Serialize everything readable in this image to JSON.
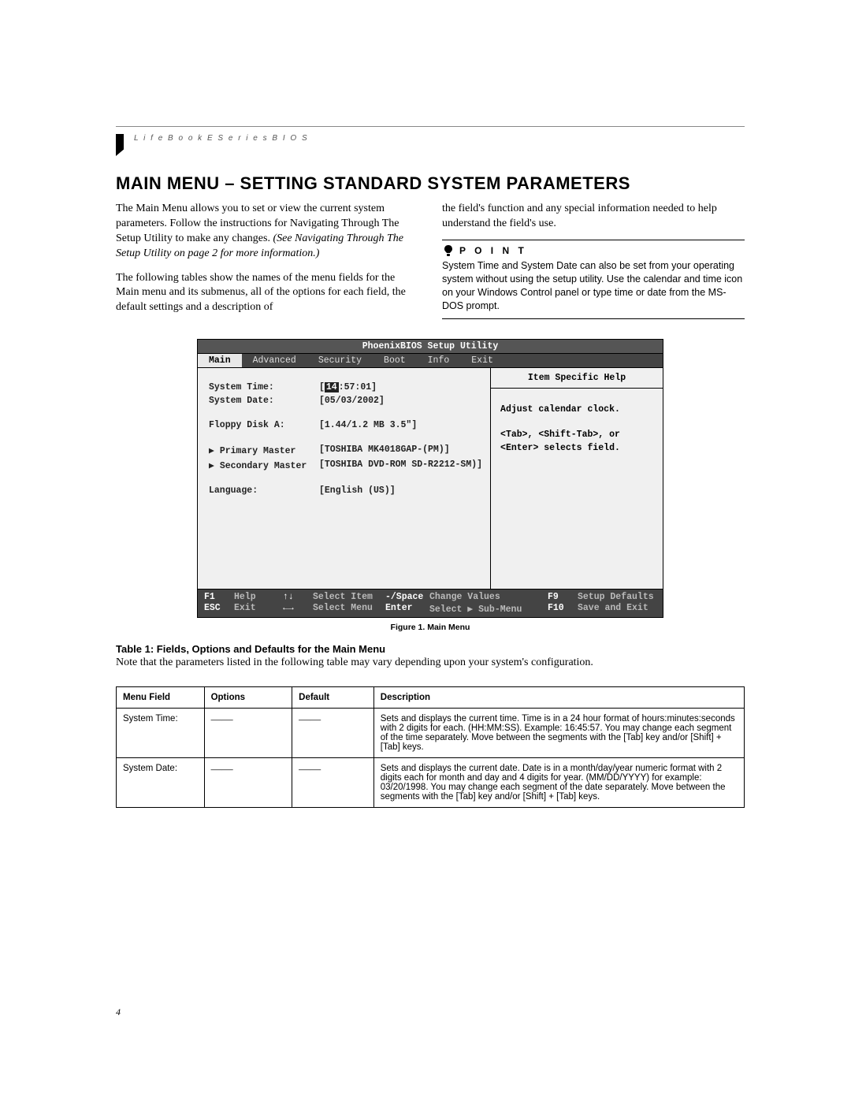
{
  "header": {
    "runningHead": "L i f e B o o k   E   S e r i e s   B I O S"
  },
  "title": "MAIN MENU – SETTING STANDARD SYSTEM PARAMETERS",
  "intro": {
    "p1": "The Main Menu allows you to set or view the current system parameters. Follow the instructions for Navigating Through The Setup Utility to make any changes. ",
    "p1_italic": "(See Navigating Through The Setup Utility on page 2 for more information.)",
    "p2": "The following tables show the names of the menu fields for the Main menu and its submenus, all of the options for each field, the default settings and a description of",
    "p3": "the field's function and any special information needed to help understand the field's use."
  },
  "point": {
    "label": "P O I N T",
    "text": "System Time and System Date can also be set from your operating system without using the setup utility. Use the calendar and time icon on your Windows Control panel or type time or date from the MS-DOS prompt."
  },
  "bios": {
    "title": "PhoenixBIOS Setup Utility",
    "menu": [
      "Main",
      "Advanced",
      "Security",
      "Boot",
      "Info",
      "Exit"
    ],
    "activeMenu": "Main",
    "rows": {
      "systemTime": {
        "label": "System Time:",
        "valPrefix": "[",
        "valHl": "14",
        "valSuffix": ":57:01]"
      },
      "systemDate": {
        "label": "System Date:",
        "val": "[05/03/2002]"
      },
      "floppy": {
        "label": "Floppy Disk A:",
        "val": "[1.44/1.2 MB 3.5\"]"
      },
      "primary": {
        "label": "▶ Primary Master",
        "val": "[TOSHIBA MK4018GAP-(PM)]"
      },
      "secondary": {
        "label": "▶ Secondary Master",
        "val": "[TOSHIBA DVD-ROM SD-R2212-SM)]"
      },
      "language": {
        "label": "Language:",
        "val": "[English (US)]"
      }
    },
    "help": {
      "title": "Item Specific Help",
      "line1": "Adjust calendar clock.",
      "line2": "<Tab>, <Shift-Tab>, or",
      "line3": "<Enter> selects field."
    },
    "footer": {
      "r1": {
        "k1": "F1",
        "l1": "Help",
        "k2": "↑↓",
        "l2": "Select Item",
        "k3": "-/Space",
        "l3": "Change Values",
        "k4": "F9",
        "l4": "Setup Defaults"
      },
      "r2": {
        "k1": "ESC",
        "l1": "Exit",
        "k2": "←→",
        "l2": "Select Menu",
        "k3": "Enter",
        "l3": "Select ▶ Sub-Menu",
        "k4": "F10",
        "l4": "Save and Exit"
      }
    }
  },
  "figureCaption": "Figure 1.  Main Menu",
  "table": {
    "title": "Table 1: Fields, Options and Defaults for the Main Menu",
    "note": "Note that the parameters listed in the following table may vary depending upon your system's configuration.",
    "headers": {
      "c1": "Menu Field",
      "c2": "Options",
      "c3": "Default",
      "c4": "Description"
    },
    "rows": [
      {
        "field": "System Time:",
        "options": "——",
        "def": "——",
        "desc": "Sets and displays the current time. Time is in a 24 hour format of hours:minutes:seconds with 2 digits for each. (HH:MM:SS). Example: 16:45:57. You may change each segment of the time separately. Move between the segments with the [Tab] key and/or [Shift] + [Tab] keys."
      },
      {
        "field": "System Date:",
        "options": "——",
        "def": "——",
        "desc": "Sets and displays the current date. Date is in a month/day/year numeric format with 2 digits each for month and day and 4 digits for year. (MM/DD/YYYY) for example: 03/20/1998. You may change each segment of the date separately. Move between the segments with the [Tab] key and/or [Shift] + [Tab] keys."
      }
    ]
  },
  "pageNumber": "4"
}
